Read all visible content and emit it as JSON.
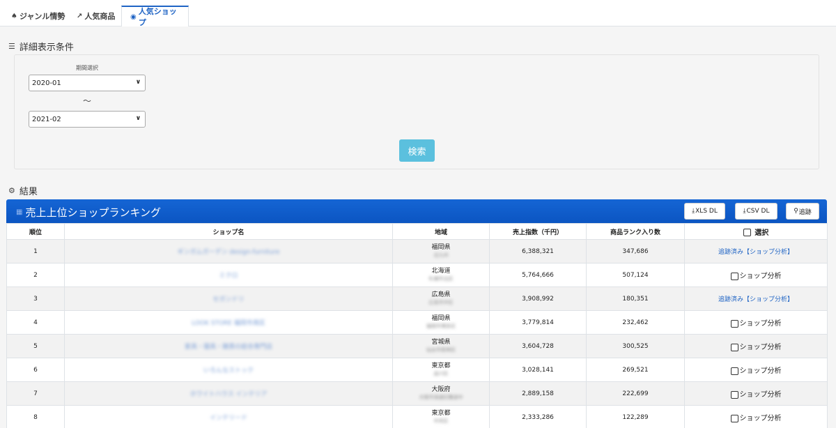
{
  "tabs": [
    {
      "label": "ジャンル情勢",
      "icon": "users-icon"
    },
    {
      "label": "人気商品",
      "icon": "chart-line-icon"
    },
    {
      "label": "人気ショップ",
      "icon": "eye-icon"
    }
  ],
  "conditions": {
    "title": "詳細表示条件",
    "period_label": "期間選択",
    "start": "2020-01",
    "tilde": "～",
    "end": "2021-02",
    "search_label": "検索"
  },
  "results": {
    "title": "結果",
    "panel_title": "売上上位ショップランキング",
    "xls_label": "XLS DL",
    "csv_label": "CSV DL",
    "track_label": "追跡",
    "columns": [
      "順位",
      "ショップ名",
      "地域",
      "売上指数（千円）",
      "商品ランク入り数",
      "選択"
    ],
    "tracked_label": "追跡済み【ショップ分析】",
    "analyze_label": "ショップ分析",
    "rows": [
      {
        "rank": "1",
        "shop": "ギンガムガーデン design-furniture",
        "pref": "福岡県",
        "city": "北九州",
        "sales": "6,388,321",
        "count": "347,686",
        "tracked": true
      },
      {
        "rank": "2",
        "shop": "ミクロ",
        "pref": "北海道",
        "city": "札幌市北区",
        "sales": "5,764,666",
        "count": "507,124",
        "tracked": false
      },
      {
        "rank": "3",
        "shop": "セガンドリ",
        "pref": "広島県",
        "city": "広島市中区",
        "sales": "3,908,992",
        "count": "180,351",
        "tracked": true
      },
      {
        "rank": "4",
        "shop": "LOOK STORE 福岡市南区",
        "pref": "福岡県",
        "city": "福岡市博多区",
        "sales": "3,779,814",
        "count": "232,462",
        "tracked": false
      },
      {
        "rank": "5",
        "shop": "家具・寝具・雑貨の総合専門店",
        "pref": "宮城県",
        "city": "仙台市若林区",
        "sales": "3,604,728",
        "count": "300,525",
        "tracked": false
      },
      {
        "rank": "6",
        "shop": "いろんなストック",
        "pref": "東京都",
        "city": "品川区",
        "sales": "3,028,141",
        "count": "269,521",
        "tracked": false
      },
      {
        "rank": "7",
        "shop": "ホワイトハウス インテリア",
        "pref": "大阪府",
        "city": "大阪市浪速区難波中",
        "sales": "2,889,158",
        "count": "222,699",
        "tracked": false
      },
      {
        "rank": "8",
        "shop": "インテリード",
        "pref": "東京都",
        "city": "中央区",
        "sales": "2,333,286",
        "count": "122,289",
        "tracked": false
      }
    ]
  }
}
